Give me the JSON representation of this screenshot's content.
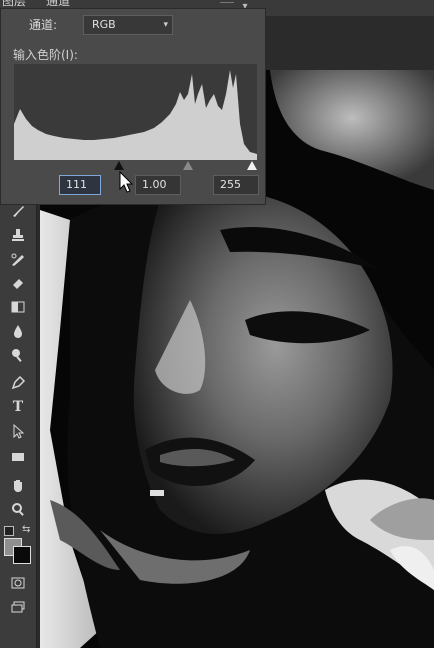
{
  "top_tabs": [
    "图层",
    "通道"
  ],
  "levels": {
    "channel_label": "通道:",
    "channel_value": "RGB",
    "input_levels_label": "输入色阶(I):",
    "input_black": "111",
    "input_gamma": "1.00",
    "input_white": "255",
    "black_point": 111,
    "white_point": 255
  },
  "toolbar": {
    "tools": [
      "brush-icon",
      "stamp-icon",
      "history-brush-icon",
      "eraser-icon",
      "gradient-icon",
      "blur-icon",
      "dodge-icon",
      "pen-icon",
      "type-icon",
      "path-select-icon",
      "rectangle-icon",
      "hand-icon",
      "zoom-icon"
    ],
    "type_tool_glyph": "T"
  },
  "colors": {
    "panel_bg": "#4a4a4a",
    "toolbar_bg": "#3c3c3c",
    "histogram_fill": "#cfcfcf",
    "foreground": "#8f8f8f",
    "background": "#0a0a0a"
  }
}
